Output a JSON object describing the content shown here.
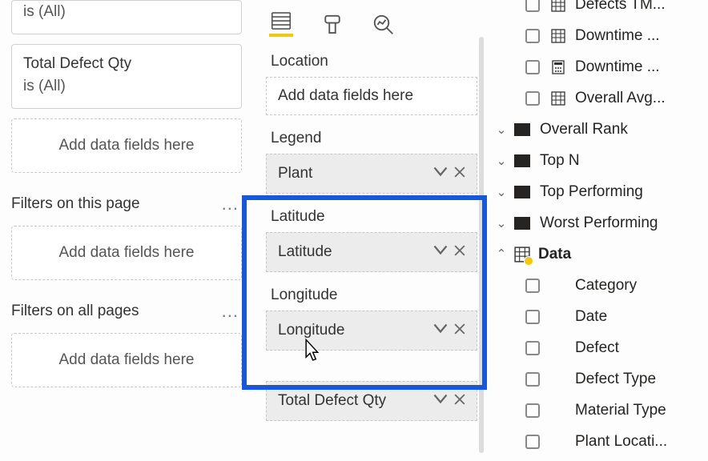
{
  "filters": {
    "card1_sub": "is (All)",
    "card2_title": "Total Defect Qty",
    "card2_sub": "is (All)",
    "drop_visual": "Add data fields here",
    "section_page": "Filters on this page",
    "drop_page": "Add data fields here",
    "section_all": "Filters on all pages",
    "drop_all": "Add data fields here"
  },
  "wells": {
    "location_label": "Location",
    "location_drop": "Add data fields here",
    "legend_label": "Legend",
    "legend_field": "Plant",
    "lat_label": "Latitude",
    "lat_field": "Latitude",
    "lon_label": "Longitude",
    "lon_field": "Longitude",
    "size_field": "Total Defect Qty"
  },
  "fields": {
    "m1": "Defects TM...",
    "m2": "Downtime ...",
    "m3": "Downtime ...",
    "m4": "Overall Avg...",
    "t1": "Overall Rank",
    "t2": "Top N",
    "t3": "Top Performing",
    "t4": "Worst Performing",
    "data_table": "Data",
    "c1": "Category",
    "c2": "Date",
    "c3": "Defect",
    "c4": "Defect Type",
    "c5": "Material Type",
    "c6": "Plant Locati..."
  }
}
